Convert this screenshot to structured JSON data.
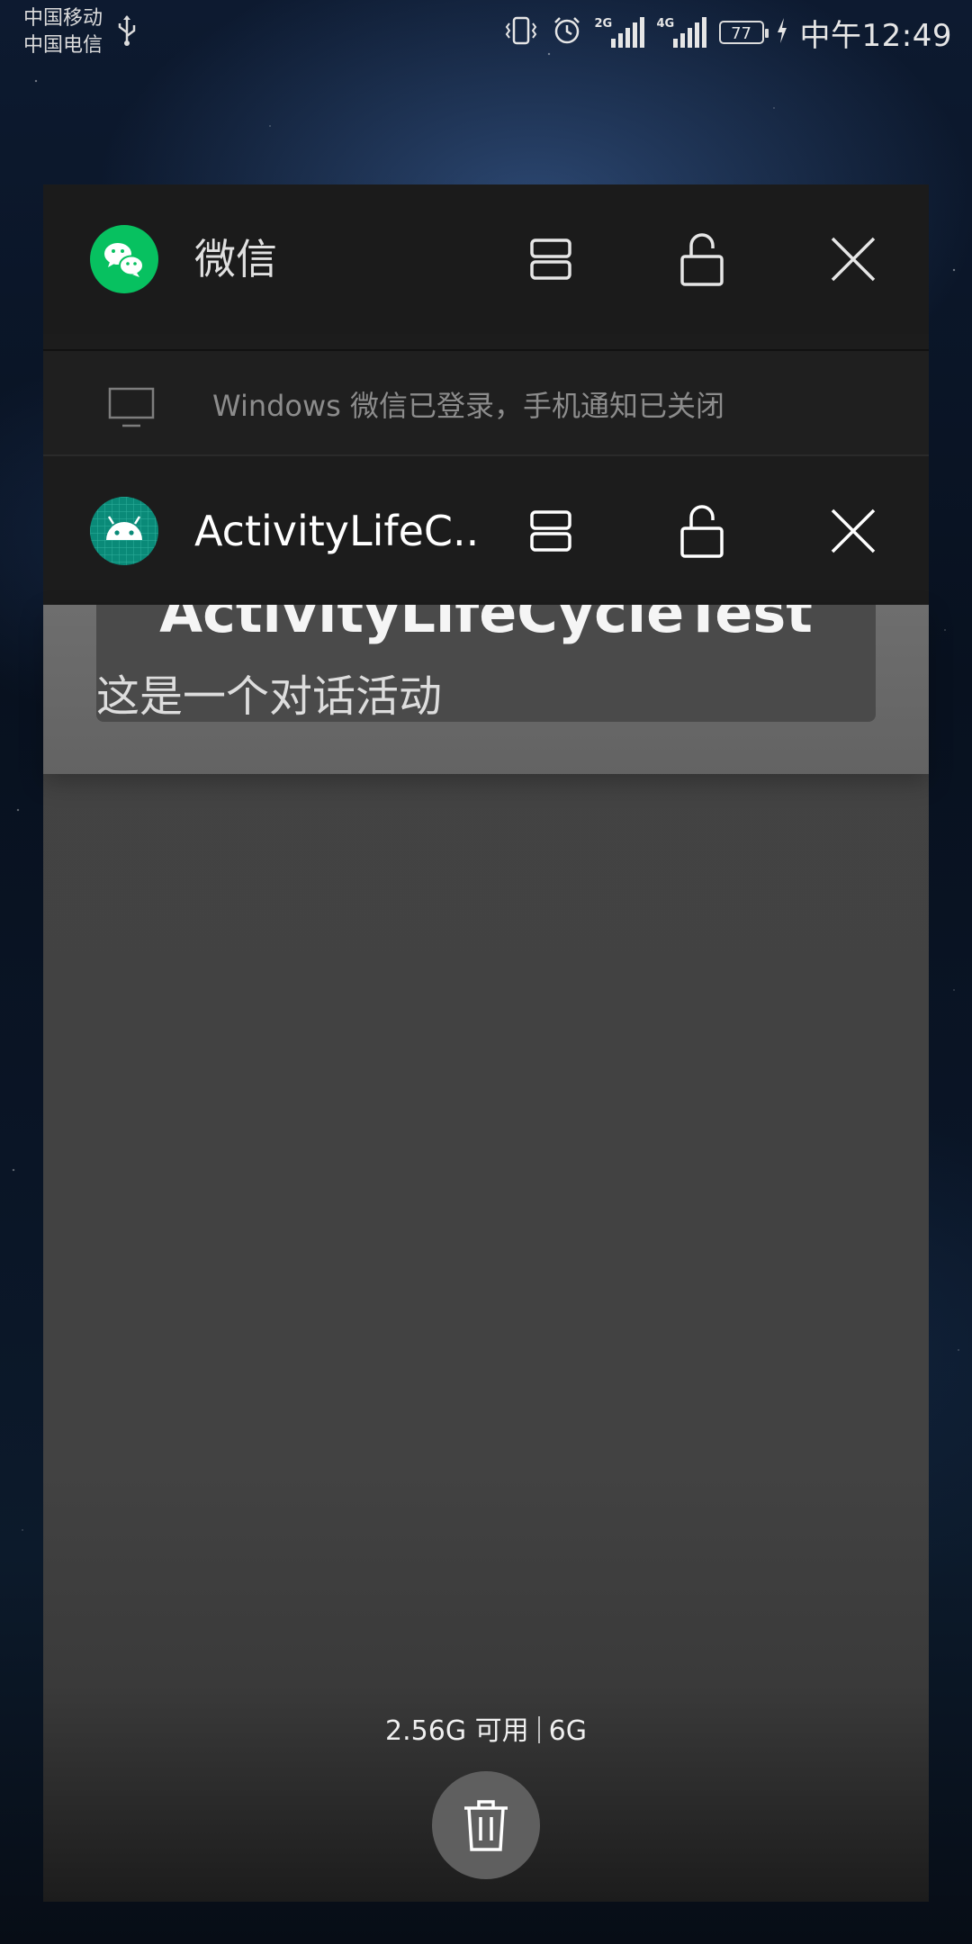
{
  "status_bar": {
    "carrier_1": "中国移动",
    "carrier_2": "中国电信",
    "signal_1_tag": "2G",
    "signal_2_tag": "4G",
    "battery": "77",
    "time": "中午12:49"
  },
  "recent_apps": [
    {
      "title": "微信",
      "icon": "wechat-icon",
      "icon_color": "#07c160",
      "notice_icon": "monitor-icon",
      "notice": "Windows 微信已登录，手机通知已关闭"
    },
    {
      "title": "ActivityLifeC..",
      "icon": "android-icon",
      "icon_color": "#0a8a78",
      "preview_title": "ActivityLifeCycleTest",
      "preview_text": "这是一个对话活动"
    }
  ],
  "memory": {
    "available": "2.56G 可用",
    "total": "6G"
  }
}
